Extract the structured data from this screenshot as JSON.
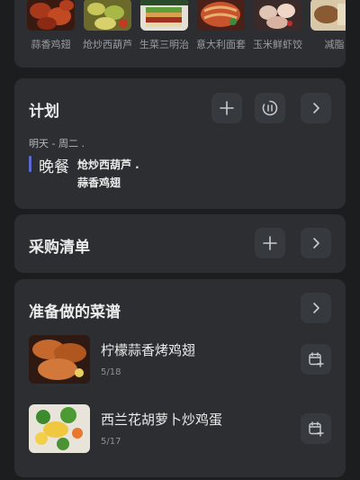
{
  "recent": {
    "items": [
      {
        "label": "蒜香鸡翅"
      },
      {
        "label": "炝炒西葫芦"
      },
      {
        "label": "生菜三明治"
      },
      {
        "label": "意大利面套"
      },
      {
        "label": "玉米鲜虾饺"
      },
      {
        "label": "减脂"
      }
    ]
  },
  "plan": {
    "title": "计划",
    "days": "明天 - 周二 .",
    "meal": "晚餐",
    "dish1": "炝炒西葫芦 .",
    "dish2": "蒜香鸡翅"
  },
  "shopping": {
    "title": "采购清单"
  },
  "recipes": {
    "title": "准备做的菜谱",
    "items": [
      {
        "name": "柠檬蒜香烤鸡翅",
        "date": "5/18"
      },
      {
        "name": "西兰花胡萝卜炒鸡蛋",
        "date": "5/17"
      }
    ]
  },
  "colors": {
    "background": "#1c1d1f",
    "card": "#2c2e31",
    "button": "#36393d",
    "accent_bar": "#5a6ad2"
  }
}
